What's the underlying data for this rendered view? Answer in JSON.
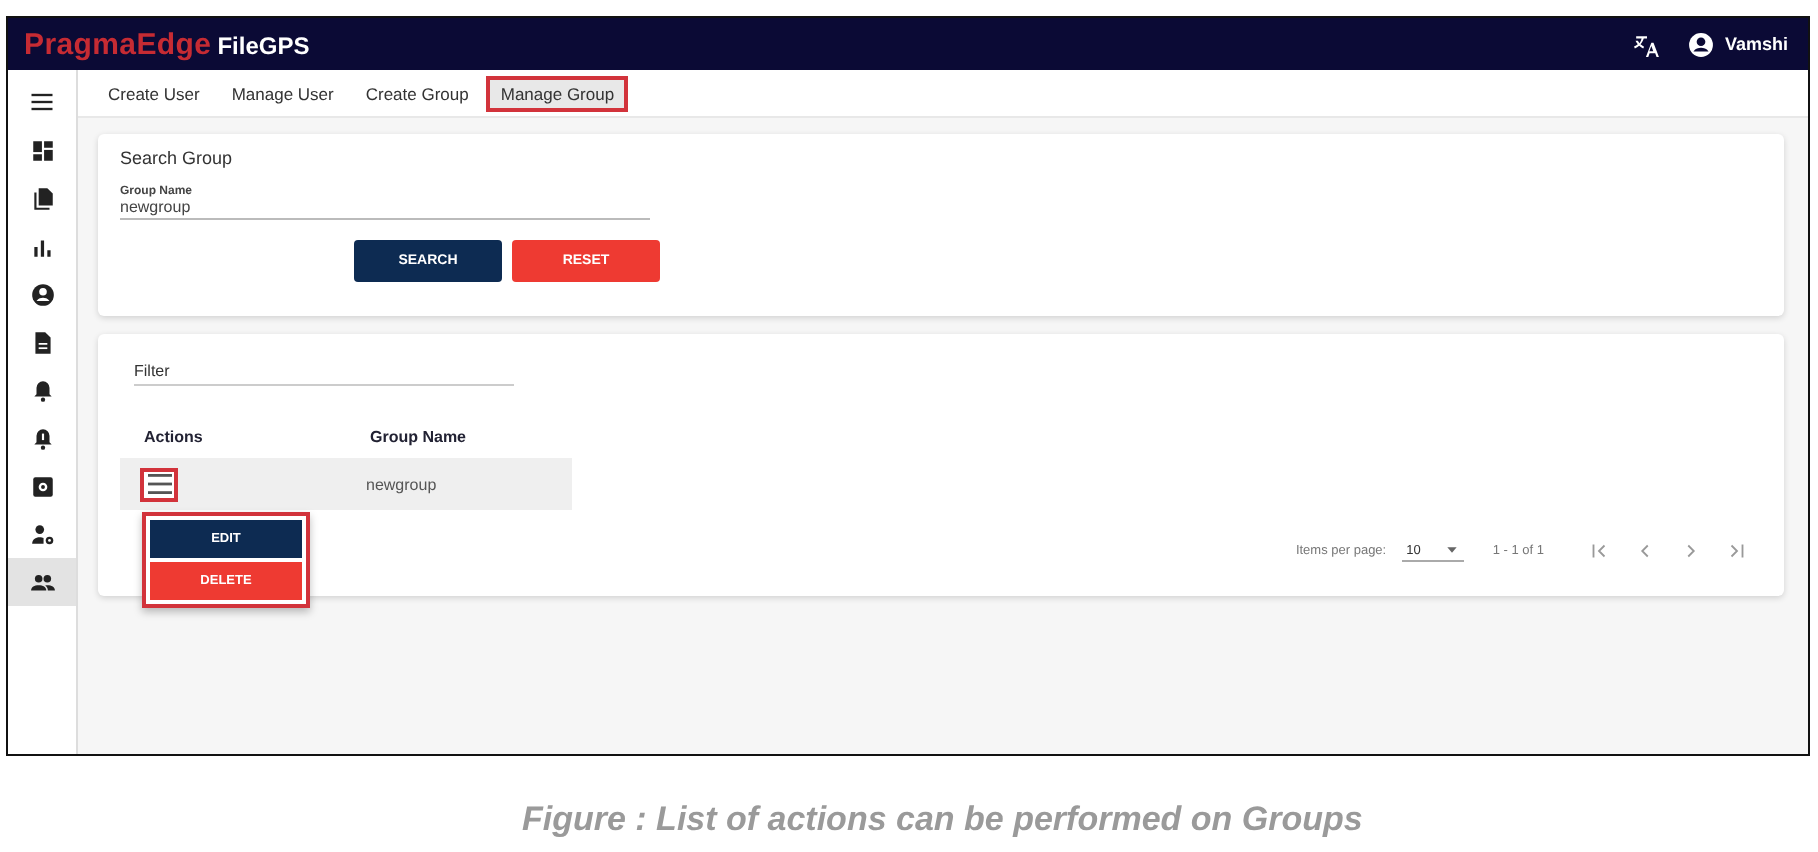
{
  "header": {
    "logo": "PragmaEdge",
    "product": "FileGPS",
    "user": "Vamshi"
  },
  "sidebar": {
    "items": [
      {
        "selected": false
      },
      {
        "selected": false
      },
      {
        "selected": false
      },
      {
        "selected": false
      },
      {
        "selected": false
      },
      {
        "selected": false
      },
      {
        "selected": false
      },
      {
        "selected": false
      },
      {
        "selected": false
      },
      {
        "selected": true
      }
    ]
  },
  "tabs": [
    {
      "label": "Create User",
      "selected": false,
      "highlighted": false
    },
    {
      "label": "Manage User",
      "selected": false,
      "highlighted": false
    },
    {
      "label": "Create Group",
      "selected": false,
      "highlighted": false
    },
    {
      "label": "Manage Group",
      "selected": true,
      "highlighted": true
    }
  ],
  "search": {
    "title": "Search Group",
    "field": {
      "label": "Group Name",
      "value": "newgroup"
    },
    "buttons": [
      {
        "label": "SEARCH",
        "kind": "primary"
      },
      {
        "label": "RESET",
        "kind": "warn"
      }
    ]
  },
  "table": {
    "filter": {
      "placeholder": "Filter"
    },
    "columns": [
      "Actions",
      "Group Name"
    ],
    "rows": [
      {
        "group_name": "newgroup",
        "highlighted": true
      }
    ],
    "row_menu": {
      "highlighted": true,
      "items": [
        {
          "label": "EDIT",
          "kind": "primary"
        },
        {
          "label": "DELETE",
          "kind": "warn"
        }
      ]
    },
    "paginator": {
      "label": "Items per page:",
      "page_size": "10",
      "range": "1 - 1 of 1"
    }
  },
  "caption": "Figure : List of actions can be performed on Groups"
}
